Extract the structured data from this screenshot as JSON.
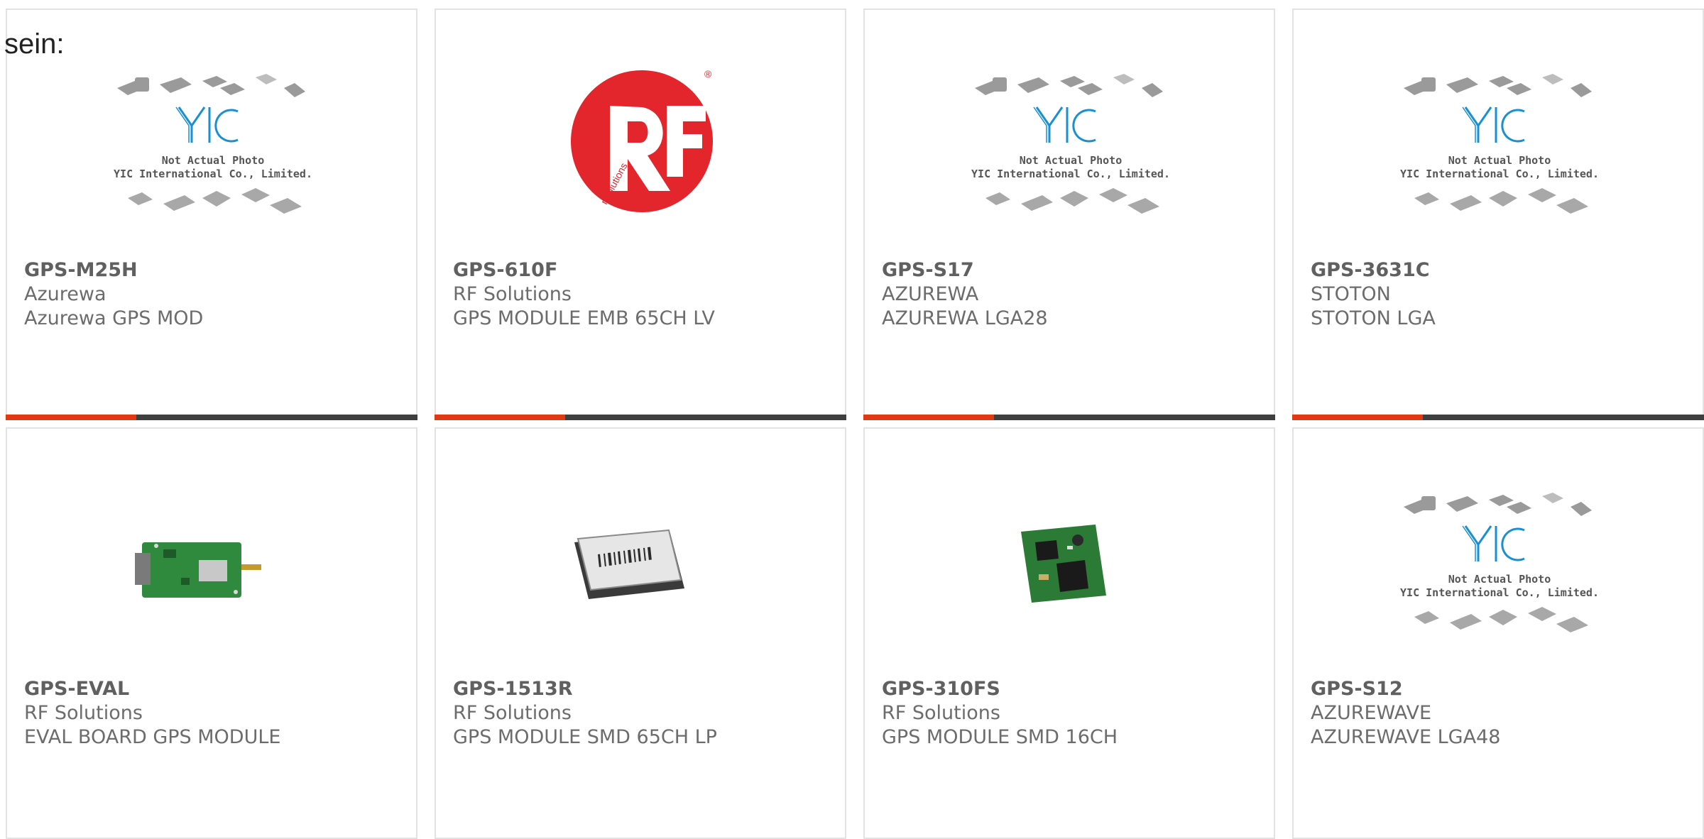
{
  "lead_text": "sein:",
  "products": [
    {
      "pn": "GPS-M25H",
      "mfr": "Azurewa",
      "desc": "Azurewa GPS MOD",
      "image": "yic-placeholder",
      "photo_note": "Not Actual Photo",
      "photo_company": "YIC International Co., Limited."
    },
    {
      "pn": "GPS-610F",
      "mfr": "RF Solutions",
      "desc": "GPS MODULE EMB 65CH LV",
      "image": "rf-solutions-logo",
      "logo_text": "rfsolutions",
      "logo_mark": "®"
    },
    {
      "pn": "GPS-S17",
      "mfr": "AZUREWA",
      "desc": "AZUREWA LGA28",
      "image": "yic-placeholder",
      "photo_note": "Not Actual Photo",
      "photo_company": "YIC International Co., Limited."
    },
    {
      "pn": "GPS-3631C",
      "mfr": "STOTON",
      "desc": "STOTON LGA",
      "image": "yic-placeholder",
      "photo_note": "Not Actual Photo",
      "photo_company": "YIC International Co., Limited."
    },
    {
      "pn": "GPS-EVAL",
      "mfr": "RF Solutions",
      "desc": "EVAL BOARD GPS MODULE",
      "image": "eval-board-photo"
    },
    {
      "pn": "GPS-1513R",
      "mfr": "RF Solutions",
      "desc": "GPS MODULE SMD 65CH LP",
      "image": "shielded-module-photo"
    },
    {
      "pn": "GPS-310FS",
      "mfr": "RF Solutions",
      "desc": "GPS MODULE SMD 16CH",
      "image": "pcb-module-photo"
    },
    {
      "pn": "GPS-S12",
      "mfr": "AZUREWAVE",
      "desc": "AZUREWAVE LGA48",
      "image": "yic-placeholder",
      "photo_note": "Not Actual Photo",
      "photo_company": "YIC International Co., Limited."
    }
  ],
  "colors": {
    "accent": "#e03a13",
    "bar_dark": "#3f3f3f",
    "card_border": "#e2e2e2",
    "logo_red": "#e3252c",
    "yic_blue": "#1a8fd1"
  }
}
